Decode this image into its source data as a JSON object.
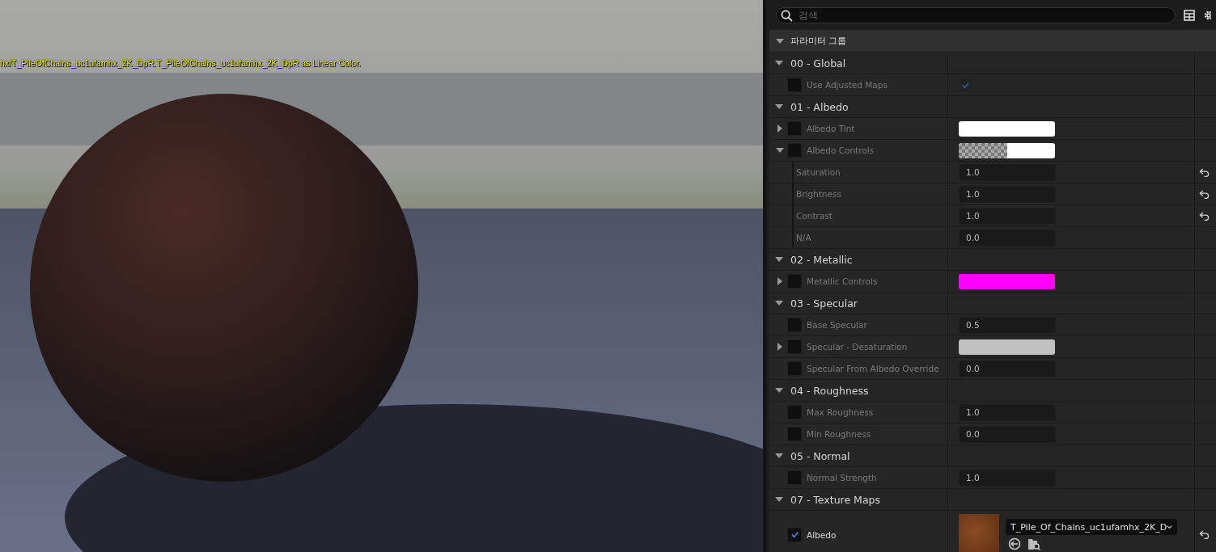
{
  "viewport": {
    "message": "hx/T_PileOfChains_uc1ufamhx_2K_DpR.T_PileOfChains_uc1ufamhx_2K_DpR as Linear Color."
  },
  "details": {
    "search": {
      "placeholder": "검색"
    },
    "section": {
      "title": "파라미터 그룹",
      "expanded": true
    },
    "groups": [
      {
        "title": "00 - Global",
        "expanded": true,
        "params": [
          {
            "name": "Use Adjusted Maps",
            "enabled": false,
            "value": {
              "kind": "checkbox",
              "checked": true
            },
            "resettable": false
          }
        ]
      },
      {
        "title": "01 - Albedo",
        "expanded": true,
        "params": [
          {
            "name": "Albedo Tint",
            "enabled": false,
            "expanded": false,
            "value": {
              "kind": "color",
              "color": "#ffffff"
            },
            "resettable": false
          },
          {
            "name": "Albedo Controls",
            "enabled": false,
            "expanded": true,
            "value": {
              "kind": "color_alpha",
              "color": "#ffffff"
            },
            "resettable": false,
            "children": [
              {
                "name": "Saturation",
                "value": {
                  "kind": "number",
                  "text": "1.0"
                },
                "resettable": true
              },
              {
                "name": "Brightness",
                "value": {
                  "kind": "number",
                  "text": "1.0"
                },
                "resettable": true
              },
              {
                "name": "Contrast",
                "value": {
                  "kind": "number",
                  "text": "1.0"
                },
                "resettable": true
              },
              {
                "name": "N/A",
                "value": {
                  "kind": "number",
                  "text": "0.0"
                },
                "resettable": false
              }
            ]
          }
        ]
      },
      {
        "title": "02 - Metallic",
        "expanded": true,
        "params": [
          {
            "name": "Metallic Controls",
            "enabled": false,
            "expanded": false,
            "value": {
              "kind": "color",
              "color": "#ff00ff"
            },
            "resettable": false
          }
        ]
      },
      {
        "title": "03 - Specular",
        "expanded": true,
        "params": [
          {
            "name": "Base Specular",
            "enabled": false,
            "value": {
              "kind": "number",
              "text": "0.5"
            },
            "resettable": false
          },
          {
            "name": "Specular - Desaturation",
            "enabled": false,
            "expanded": false,
            "value": {
              "kind": "color",
              "color": "#c0c0c0"
            },
            "resettable": false
          },
          {
            "name": "Specular From Albedo Override",
            "enabled": false,
            "value": {
              "kind": "number",
              "text": "0.0"
            },
            "resettable": false
          }
        ]
      },
      {
        "title": "04 - Roughness",
        "expanded": true,
        "params": [
          {
            "name": "Max Roughness",
            "enabled": false,
            "value": {
              "kind": "number",
              "text": "1.0"
            },
            "resettable": false
          },
          {
            "name": "Min Roughness",
            "enabled": false,
            "value": {
              "kind": "number",
              "text": "0.0"
            },
            "resettable": false
          }
        ]
      },
      {
        "title": "05 - Normal",
        "expanded": true,
        "params": [
          {
            "name": "Normal Strength",
            "enabled": false,
            "value": {
              "kind": "number",
              "text": "1.0"
            },
            "resettable": false
          }
        ]
      },
      {
        "title": "07 - Texture Maps",
        "expanded": true,
        "params": [
          {
            "name": "Albedo",
            "enabled": true,
            "value": {
              "kind": "texture",
              "text": "T_Pile_Of_Chains_uc1ufamhx_2K_D"
            },
            "resettable": true
          }
        ]
      }
    ]
  }
}
